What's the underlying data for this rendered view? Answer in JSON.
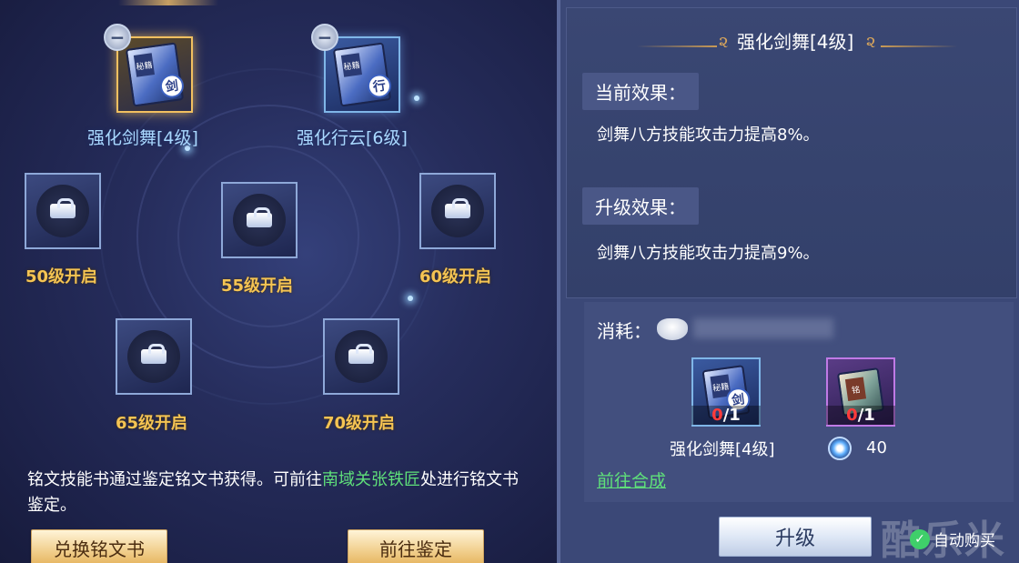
{
  "left_panel": {
    "equipped": [
      {
        "name": "强化剑舞[4级]",
        "glyph": "剑",
        "tag": "秘籍"
      },
      {
        "name": "强化行云[6级]",
        "glyph": "行",
        "tag": "秘籍"
      }
    ],
    "remove_symbol": "−",
    "locked_slots": [
      {
        "label": "50级开启"
      },
      {
        "label": "55级开启"
      },
      {
        "label": "60级开启"
      },
      {
        "label": "65级开启"
      },
      {
        "label": "70级开启"
      }
    ],
    "description": {
      "part1": "铭文技能书通过鉴定铭文书获得。可前往",
      "highlight": "南域关张铁匠",
      "part2": "处进行铭文书鉴定。"
    },
    "buttons": {
      "exchange": "兑换铭文书",
      "goto_appraise": "前往鉴定"
    }
  },
  "right_panel": {
    "title": "强化剑舞[4级]",
    "title_ornament": "૨",
    "current_effect_label": "当前效果：",
    "current_effect": "剑舞八方技能攻击力提高8%。",
    "upgrade_effect_label": "升级效果：",
    "upgrade_effect": "剑舞八方技能攻击力提高9%。",
    "cost_label": "消耗：",
    "items": [
      {
        "name": "强化剑舞[4级]",
        "owned": "0",
        "required": "/1",
        "glyph": "剑",
        "tag": "秘籍"
      },
      {
        "owned": "0",
        "required": "/1",
        "tag": "铭"
      }
    ],
    "currency_amount": "40",
    "synthesis_link": "前往合成",
    "upgrade_button": "升级",
    "auto_buy_label": "自动购买",
    "auto_buy_check": "✓",
    "watermark": "酷乐米"
  },
  "colors": {
    "gold_text": "#f5c453",
    "green_highlight": "#5fe07a",
    "skill_name": "#a9d8ff",
    "red_count": "#ff3b3b"
  }
}
